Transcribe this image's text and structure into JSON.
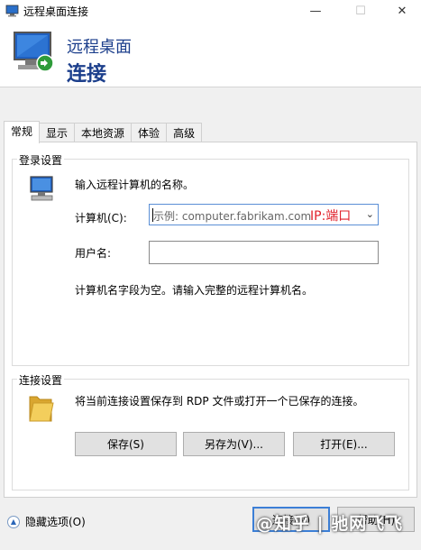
{
  "window": {
    "title": "远程桌面连接",
    "min_glyph": "—",
    "max_glyph": "☐",
    "close_glyph": "✕"
  },
  "header": {
    "line1": "远程桌面",
    "line2": "连接"
  },
  "tabs": [
    {
      "label": "常规",
      "active": true
    },
    {
      "label": "显示",
      "active": false
    },
    {
      "label": "本地资源",
      "active": false
    },
    {
      "label": "体验",
      "active": false
    },
    {
      "label": "高级",
      "active": false
    }
  ],
  "login_settings": {
    "legend": "登录设置",
    "instruction": "输入远程计算机的名称。",
    "computer_label": "计算机(C):",
    "computer_placeholder": "示例: computer.fabrikam.com",
    "computer_hint": "IP:端口",
    "username_label": "用户名:",
    "username_value": "",
    "empty_note": "计算机名字段为空。请输入完整的远程计算机名。"
  },
  "connection_settings": {
    "legend": "连接设置",
    "description": "将当前连接设置保存到 RDP 文件或打开一个已保存的连接。",
    "save_label": "保存(S)",
    "save_as_label": "另存为(V)...",
    "open_label": "打开(E)..."
  },
  "footer": {
    "hide_options_label": "隐藏选项(O)",
    "connect_label": "连接(N)",
    "help_label": "帮助(H)",
    "watermark": "@知乎 | 驰网飞飞"
  },
  "colors": {
    "accent": "#1c3f8c",
    "hint_red": "#e0202a",
    "focus_blue": "#3c7fd6"
  }
}
